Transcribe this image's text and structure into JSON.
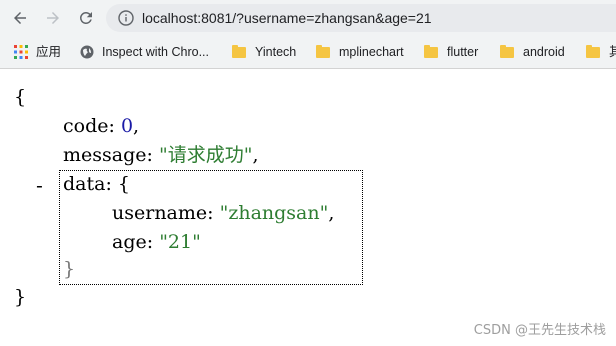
{
  "browser": {
    "url": "localhost:8081/?username=zhangsan&age=21",
    "bookmarks": [
      {
        "label": "应用",
        "icon": "apps-grid-icon"
      },
      {
        "label": "Inspect with Chro...",
        "icon": "globe-icon"
      },
      {
        "label": "Yintech",
        "icon": "folder-icon"
      },
      {
        "label": "mplinechart",
        "icon": "folder-icon"
      },
      {
        "label": "flutter",
        "icon": "folder-icon"
      },
      {
        "label": "android",
        "icon": "folder-icon"
      },
      {
        "label": "其",
        "icon": "folder-icon"
      }
    ]
  },
  "json_view": {
    "open_brace": "{",
    "code_key": "code",
    "code_value": "0",
    "message_key": "message",
    "message_value": "\"请求成功\"",
    "data_key": "data",
    "data_open": "{",
    "username_key": "username",
    "username_value": "\"zhangsan\"",
    "age_key": "age",
    "age_value": "\"21\"",
    "data_close": "}",
    "close_brace": "}",
    "collapse_toggle": "-"
  },
  "watermark": "CSDN @王先生技术栈"
}
